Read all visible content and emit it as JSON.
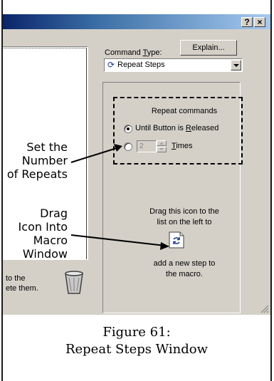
{
  "window": {
    "help_button": "?",
    "close_button": "×"
  },
  "command_type": {
    "label_prefix": "Command ",
    "label_access_key": "T",
    "label_suffix": "ype:",
    "selected": "Repeat Steps",
    "selected_icon": "repeat-icon"
  },
  "explain_button": "Explain...",
  "repeat": {
    "heading": "Repeat commands",
    "until_prefix": "Until Button is ",
    "until_access_key": "R",
    "until_suffix": "eleased",
    "until_selected": true,
    "count_value": "2",
    "times_access_key": "T",
    "times_suffix": "imes"
  },
  "drag": {
    "line1": "Drag this icon to the",
    "line2": "list on the left to",
    "add_line1": "add a new step to",
    "add_line2": "the macro.",
    "icon": "repeat-icon"
  },
  "delete_area": {
    "line1": "to the",
    "line2": "ete them.",
    "icon": "trash-icon"
  },
  "callouts": {
    "repeats_line1": "Set the",
    "repeats_line2": "Number",
    "repeats_line3": "of Repeats",
    "drag_line1": "Drag",
    "drag_line2": "Icon Into",
    "drag_line3": "Macro",
    "drag_line4": "Window"
  },
  "caption": {
    "line1": "Figure 61:",
    "line2": "Repeat Steps Window"
  }
}
